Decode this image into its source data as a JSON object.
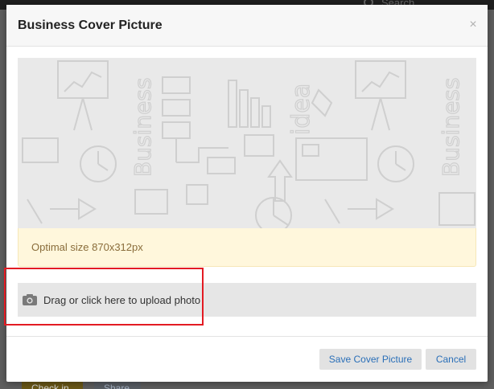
{
  "background": {
    "search_placeholder": "Search",
    "checkin_label": "Check in",
    "share_label": "Share"
  },
  "modal": {
    "title": "Business Cover Picture",
    "close_glyph": "×",
    "cover_icon_names": [
      "presentation-board-icon",
      "flowchart-icon",
      "bar-chart-icon",
      "idea-text-icon",
      "clock-icon",
      "credit-card-icon",
      "pie-chart-icon"
    ],
    "cover_sketch_words": [
      "Business",
      "idea",
      "Business"
    ],
    "optimal_size_text": "Optimal size 870x312px",
    "upload_label": "Drag or click here to upload photo",
    "save_label": "Save Cover Picture",
    "cancel_label": "Cancel"
  },
  "colors": {
    "alert_bg": "#fff7dc",
    "alert_text": "#8a6d3b",
    "highlight": "#e31b23",
    "button_text": "#2a6fb8"
  }
}
